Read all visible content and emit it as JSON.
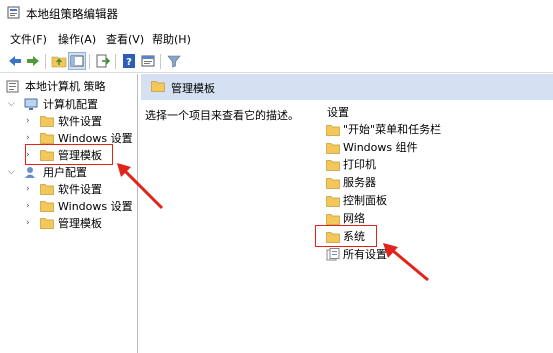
{
  "window": {
    "title": "本地组策略编辑器"
  },
  "menu": {
    "items": [
      "文件(F)",
      "操作(A)",
      "查看(V)",
      "帮助(H)"
    ]
  },
  "toolbar": {
    "icons": [
      "back-arrow-icon",
      "forward-arrow-icon",
      "up-folder-icon",
      "show-hide-tree-icon",
      "export-list-icon",
      "help-icon",
      "properties-icon",
      "filter-icon"
    ]
  },
  "tree": {
    "root": "本地计算机 策略",
    "computer": {
      "label": "计算机配置",
      "children": [
        "软件设置",
        "Windows 设置",
        "管理模板"
      ]
    },
    "user": {
      "label": "用户配置",
      "children": [
        "软件设置",
        "Windows 设置",
        "管理模板"
      ]
    }
  },
  "right": {
    "header": "管理模板",
    "description": "选择一个项目来查看它的描述。",
    "column_header": "设置",
    "items": [
      "\"开始\"菜单和任务栏",
      "Windows 组件",
      "打印机",
      "服务器",
      "控制面板",
      "网络",
      "系统",
      "所有设置"
    ]
  },
  "colors": {
    "highlight_box": "#e2231a",
    "arrow": "#e2231a",
    "header_bg": "#d5e1f2",
    "folder": "#f3c75a"
  }
}
